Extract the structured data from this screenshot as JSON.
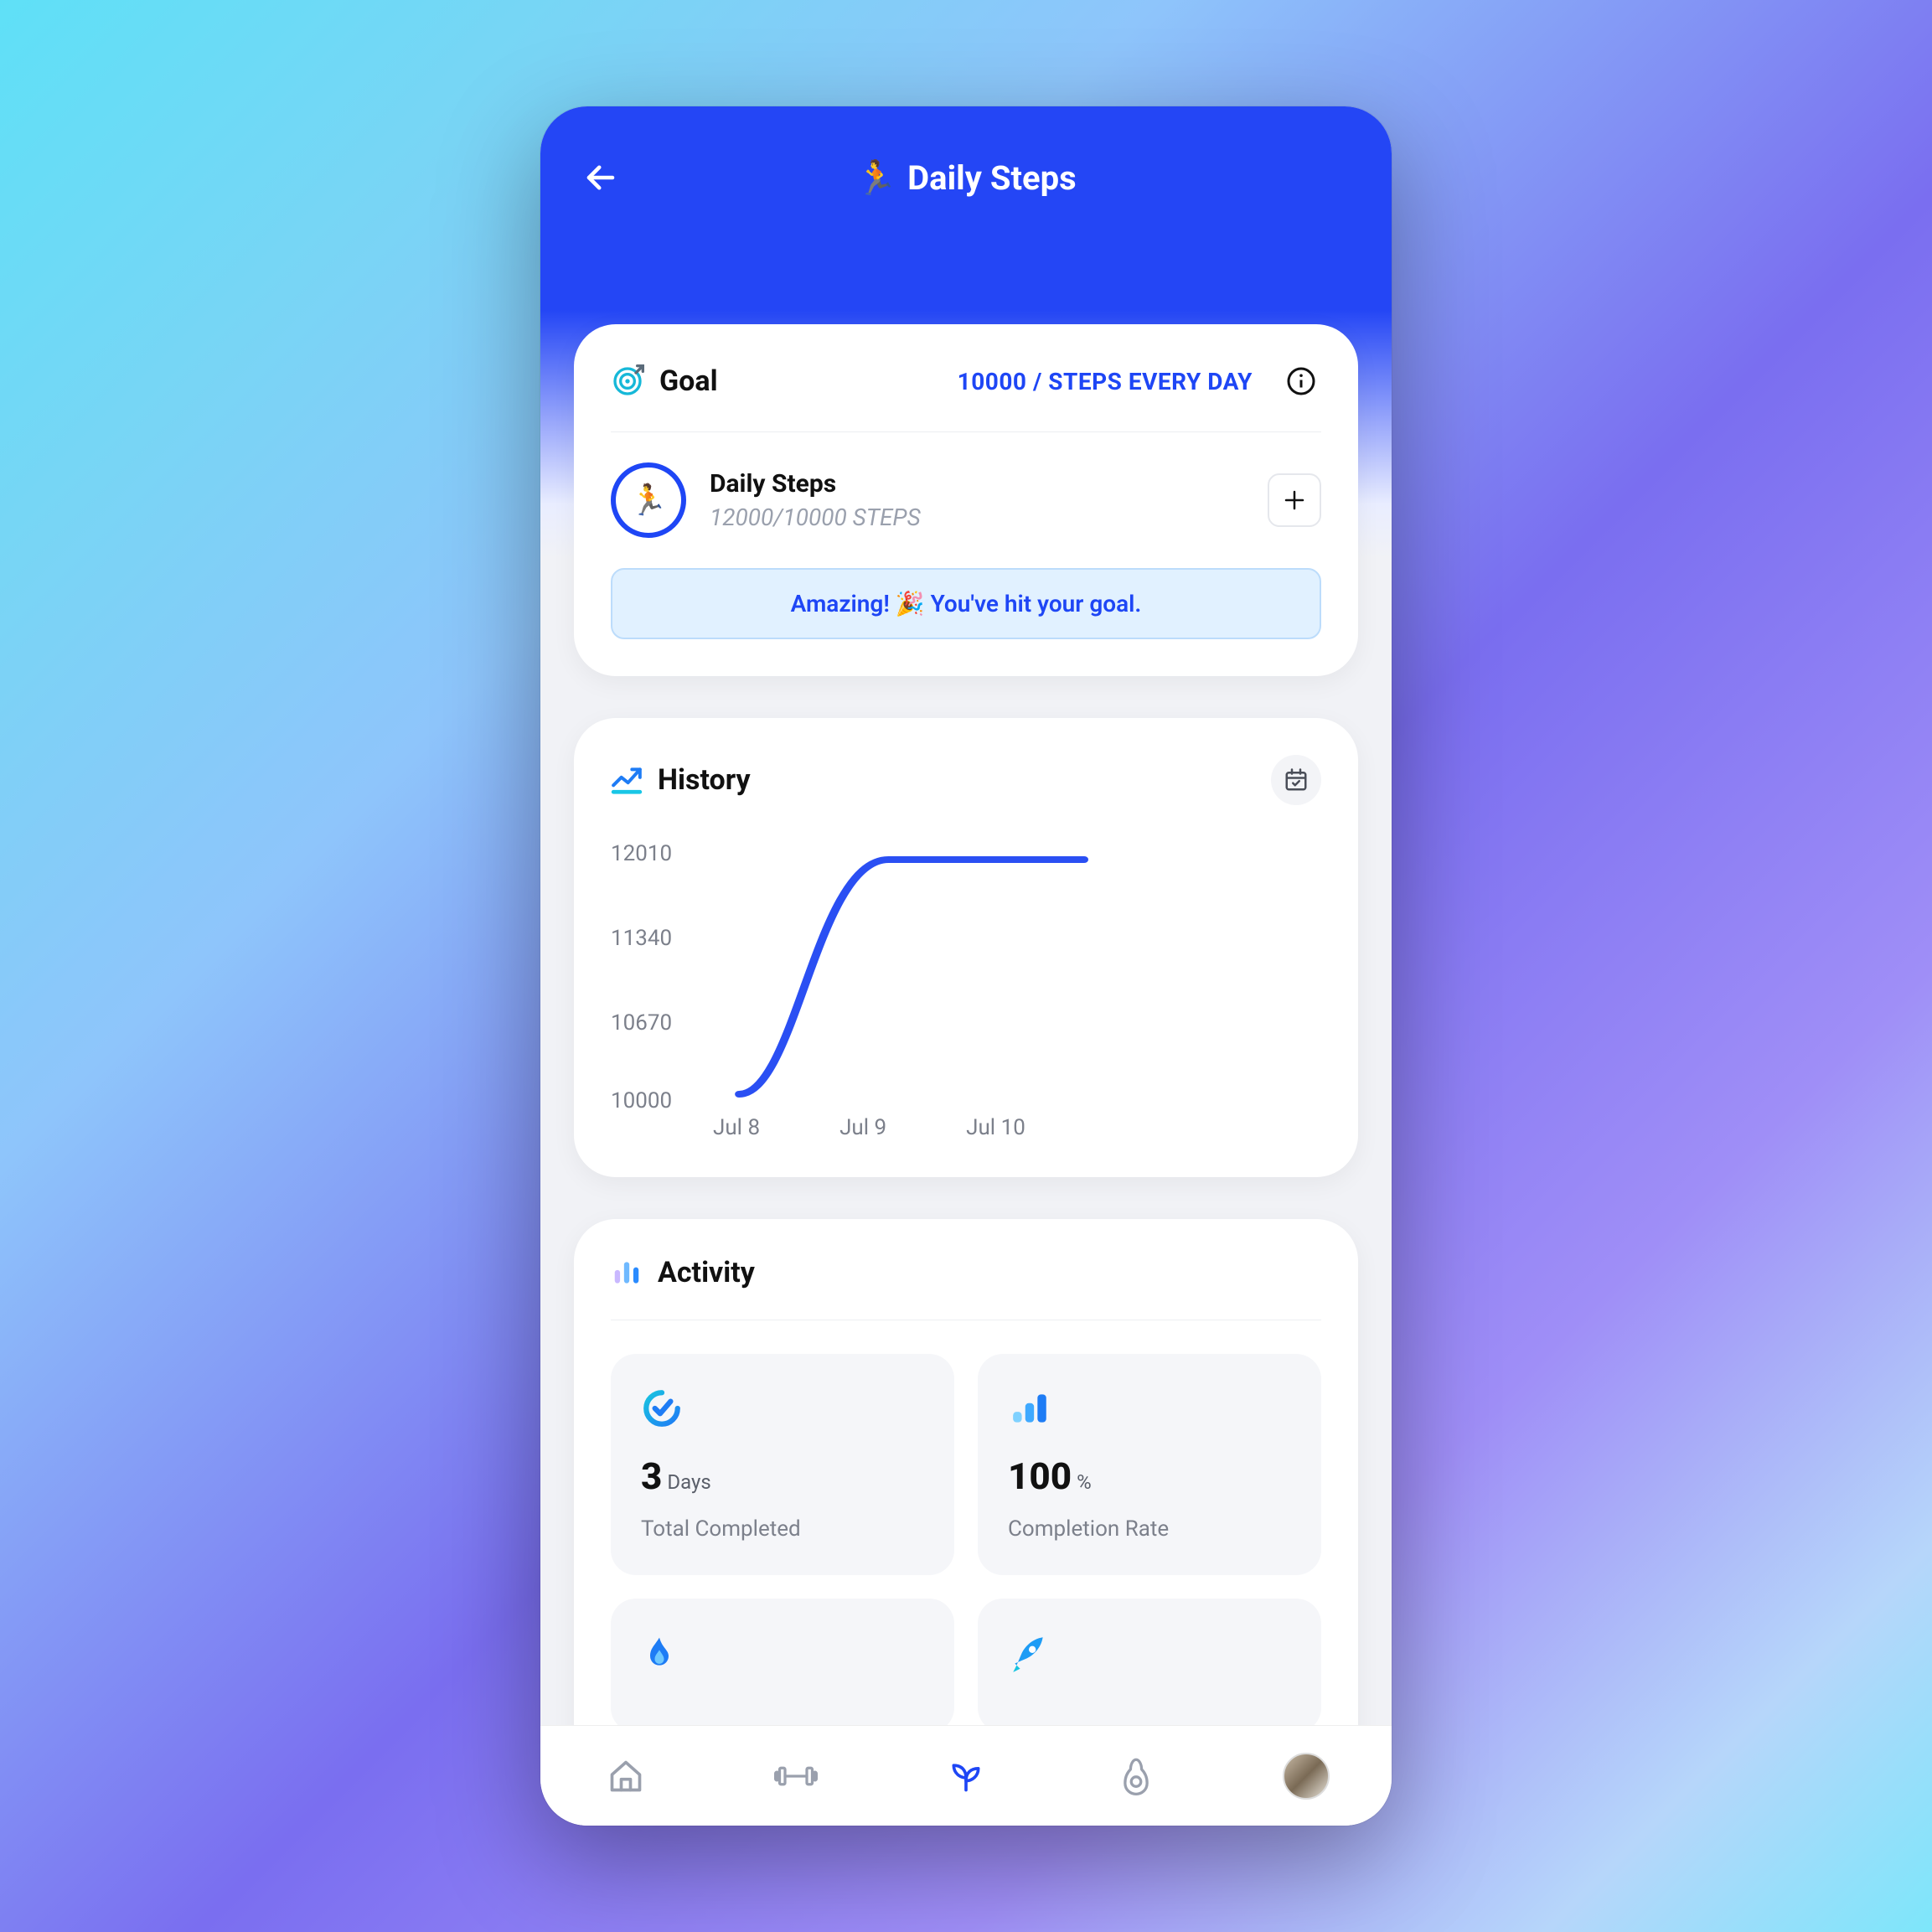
{
  "header": {
    "title_icon": "🏃",
    "title": "Daily Steps"
  },
  "goal_card": {
    "heading": "Goal",
    "goal_text": "10000 / STEPS EVERY DAY",
    "item_title": "Daily Steps",
    "item_subtitle": "12000/10000 STEPS",
    "item_emoji": "🏃",
    "banner": "Amazing! 🎉 You've hit your goal."
  },
  "history_card": {
    "heading": "History"
  },
  "chart_data": {
    "type": "line",
    "title": "",
    "xlabel": "",
    "ylabel": "",
    "categories": [
      "Jul 8",
      "Jul 9",
      "Jul 10"
    ],
    "values": [
      10000,
      12010,
      12010
    ],
    "ylim": [
      10000,
      12010
    ],
    "yticks": [
      10000,
      10670,
      11340,
      12010
    ]
  },
  "activity_card": {
    "heading": "Activity",
    "tiles": [
      {
        "value": "3",
        "unit": "Days",
        "sub": "Total Completed"
      },
      {
        "value": "100",
        "unit": "%",
        "sub": "Completion Rate"
      }
    ]
  }
}
